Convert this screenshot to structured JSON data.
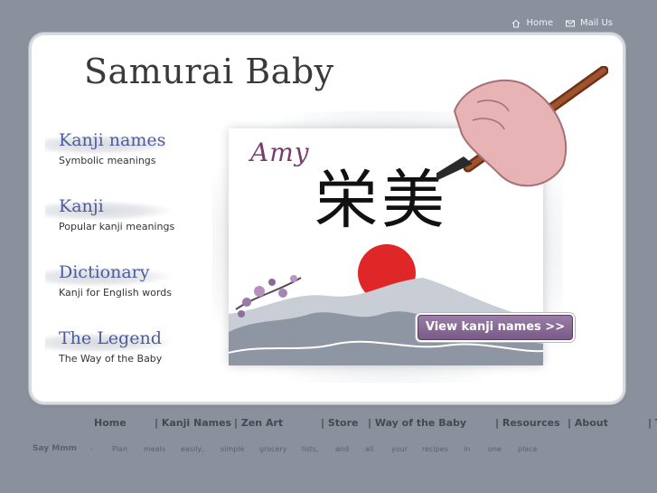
{
  "top_nav": {
    "home": "Home",
    "mail": "Mail Us"
  },
  "site_title": "Samurai Baby",
  "menu": [
    {
      "title": "Kanji names",
      "subtitle": "Symbolic meanings"
    },
    {
      "title": "Kanji",
      "subtitle": "Popular kanji meanings"
    },
    {
      "title": "Dictionary",
      "subtitle": "Kanji for English words"
    },
    {
      "title": "The Legend",
      "subtitle": "The Way of the Baby"
    }
  ],
  "feature": {
    "name": "Amy",
    "kanji": "栄美",
    "button": "View kanji names >>"
  },
  "bottom_nav": [
    "Home",
    "| Kanji Names",
    "| Zen Art",
    "| Store",
    "| Way of the Baby",
    "| Resources",
    "| About",
    "| T"
  ],
  "promo": {
    "label": "Say Mmm",
    "dash": "-",
    "words": [
      "Plan",
      "meals",
      "easily,",
      "simple",
      "grocery",
      "lists,",
      "and",
      "all",
      "your",
      "recipes",
      "in",
      "one",
      "place"
    ]
  },
  "colors": {
    "background": "#8a919c",
    "menu_title": "#4b5ba0",
    "button": "#8a6c98",
    "name": "#7a3b6e"
  },
  "icons": [
    "home-icon",
    "mail-icon"
  ]
}
